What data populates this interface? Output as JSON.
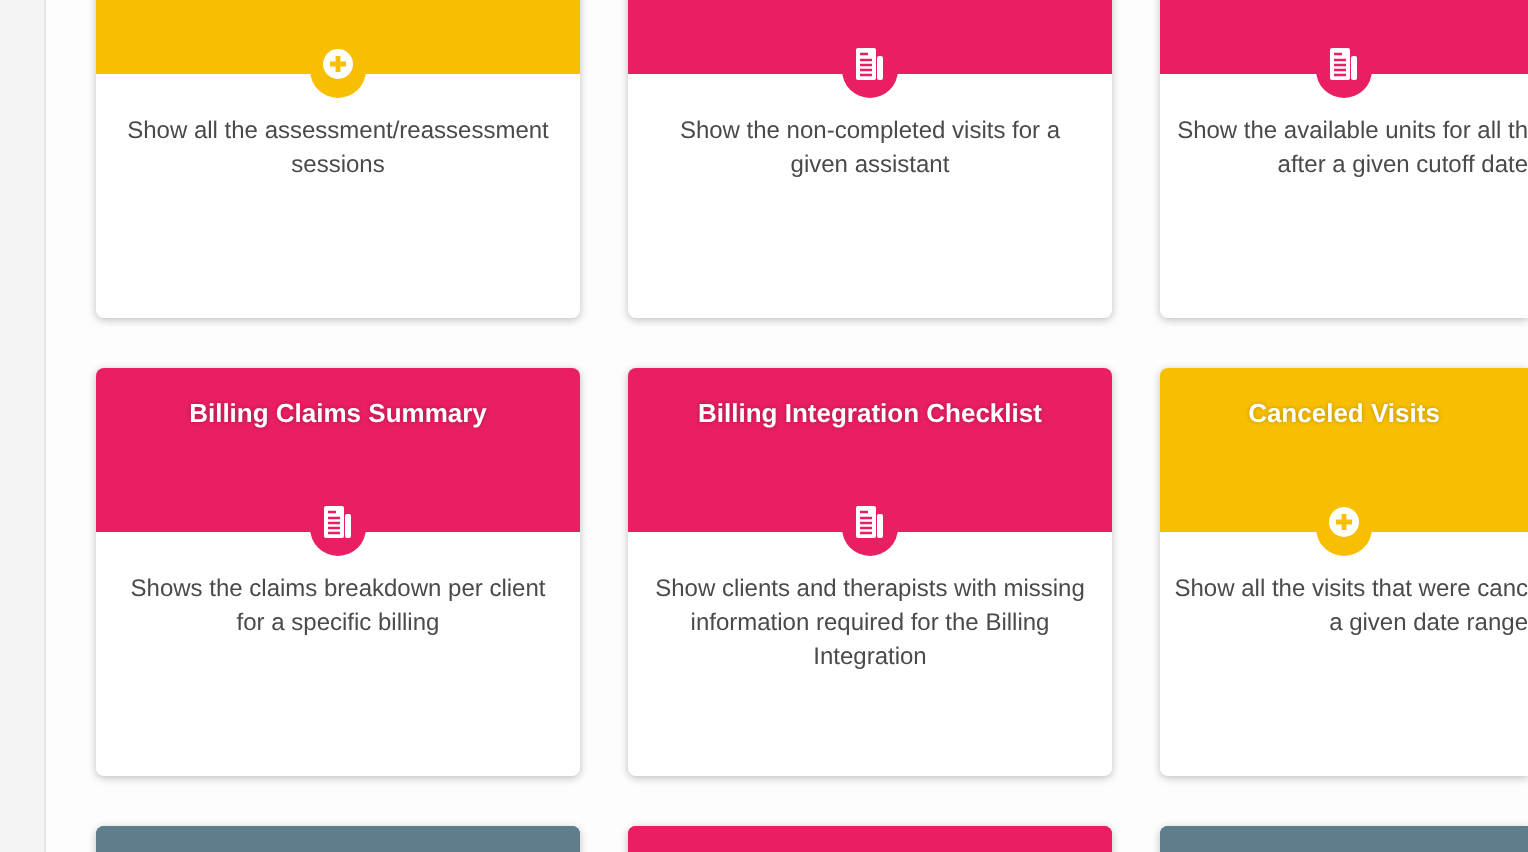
{
  "rows": [
    {
      "cards": [
        {
          "kind": "add",
          "color": "#f8bf00",
          "description": [
            "Show all the assessment/reassessment",
            "sessions"
          ]
        },
        {
          "kind": "report",
          "color": "#e91e63",
          "description": [
            "Show the non-completed visits for a",
            "given assistant"
          ]
        },
        {
          "kind": "report",
          "color": "#e91e63",
          "description": [
            "Show the available units for all th",
            "after a given cutoff date"
          ]
        }
      ]
    },
    {
      "cards": [
        {
          "title": "Billing Claims Summary",
          "kind": "report",
          "color": "#e91e63",
          "description": [
            "Shows the claims breakdown per client",
            "for a specific billing"
          ]
        },
        {
          "title": "Billing Integration Checklist",
          "kind": "report",
          "color": "#e91e63",
          "description": [
            "Show clients and therapists with missing",
            "information required for the Billing",
            "Integration"
          ]
        },
        {
          "title": "Canceled Visits",
          "kind": "add",
          "color": "#f8bf00",
          "description": [
            "Show all the visits that were canc",
            "a given date range"
          ]
        }
      ]
    },
    {
      "cards": [
        {
          "color": "#607d8b"
        },
        {
          "color": "#e91e63"
        },
        {
          "color": "#607d8b"
        }
      ]
    }
  ]
}
